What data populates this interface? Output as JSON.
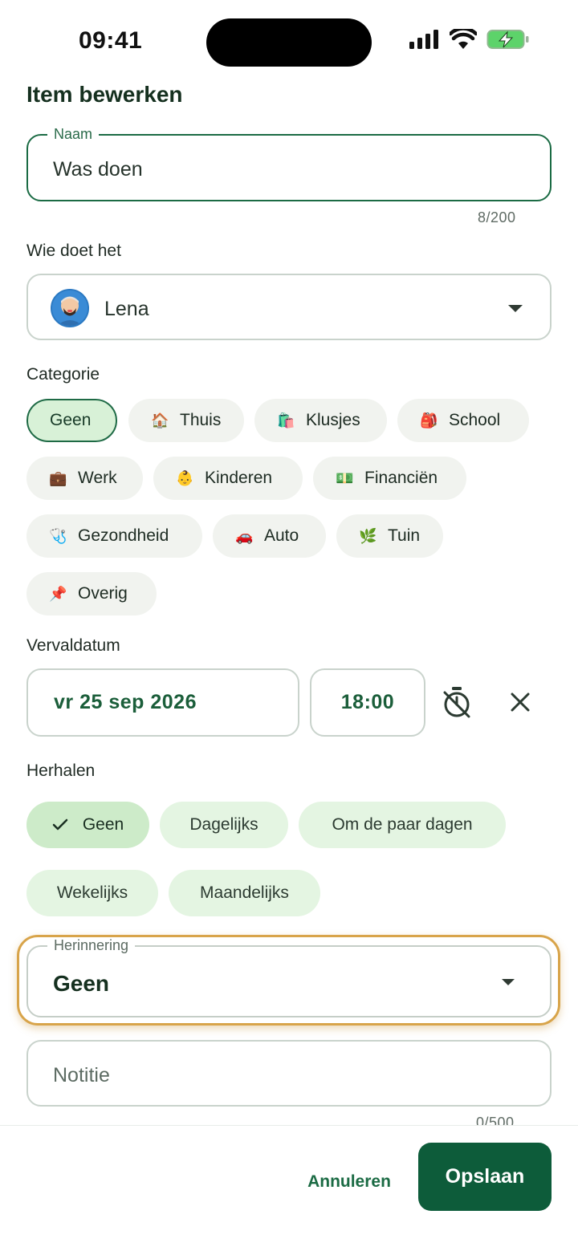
{
  "status": {
    "time": "09:41"
  },
  "page": {
    "title": "Item bewerken"
  },
  "name_field": {
    "legend": "Naam",
    "value": "Was doen",
    "counter": "8/200"
  },
  "assignee": {
    "label": "Wie doet het",
    "value": "Lena"
  },
  "category": {
    "label": "Categorie",
    "chips": [
      {
        "label": "Geen",
        "emoji": "",
        "selected": true
      },
      {
        "label": "Thuis",
        "emoji": "🏠"
      },
      {
        "label": "Klusjes",
        "emoji": "🛍️"
      },
      {
        "label": "School",
        "emoji": "🎒"
      },
      {
        "label": "Werk",
        "emoji": "💼"
      },
      {
        "label": "Kinderen",
        "emoji": "👶"
      },
      {
        "label": "Financiën",
        "emoji": "💵"
      },
      {
        "label": "Gezondheid",
        "emoji": "🩺"
      },
      {
        "label": "Auto",
        "emoji": "🚗"
      },
      {
        "label": "Tuin",
        "emoji": "🌿"
      },
      {
        "label": "Overig",
        "emoji": "📌"
      }
    ]
  },
  "due": {
    "label": "Vervaldatum",
    "date": "vr 25 sep 2026",
    "time": "18:00"
  },
  "repeat": {
    "label": "Herhalen",
    "options": [
      {
        "label": "Geen",
        "selected": true
      },
      {
        "label": "Dagelijks"
      },
      {
        "label": "Om de paar dagen"
      },
      {
        "label": "Wekelijks"
      },
      {
        "label": "Maandelijks"
      }
    ]
  },
  "reminder": {
    "legend": "Herinnering",
    "value": "Geen"
  },
  "note": {
    "placeholder": "Notitie",
    "counter": "0/500"
  },
  "footer": {
    "cancel_label": "Annuleren",
    "save_label": "Opslaan"
  },
  "colors": {
    "primary": "#0d5c3a",
    "highlight": "#d8a44a",
    "chip_selected": "#d8f1d7",
    "repeat_chip": "#e4f5e2"
  }
}
